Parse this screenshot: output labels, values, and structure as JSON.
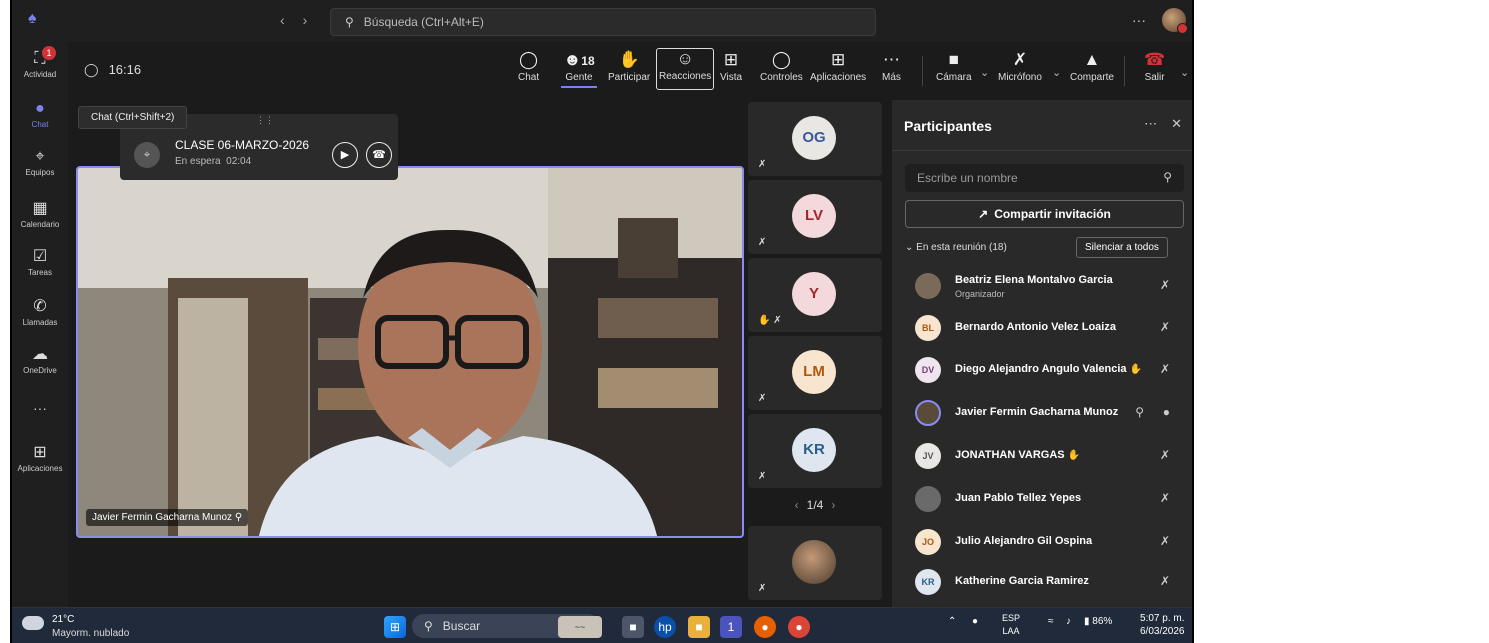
{
  "titlebar": {
    "search_placeholder": "Búsqueda (Ctrl+Alt+E)",
    "more": "···"
  },
  "rail": {
    "activity_badge": "1",
    "items": [
      {
        "label": "Actividad",
        "icon": "bell-icon"
      },
      {
        "label": "Chat",
        "icon": "chat-icon"
      },
      {
        "label": "Equipos",
        "icon": "teams-icon"
      },
      {
        "label": "Calendario",
        "icon": "calendar-icon"
      },
      {
        "label": "Tareas",
        "icon": "tasks-icon"
      },
      {
        "label": "Llamadas",
        "icon": "phone-icon"
      },
      {
        "label": "OneDrive",
        "icon": "cloud-icon"
      },
      {
        "label": "···",
        "icon": "more-icon"
      },
      {
        "label": "Aplicaciones",
        "icon": "apps-icon"
      }
    ]
  },
  "meeting": {
    "elapsed": "16:16",
    "people_count": "18",
    "buttons": {
      "chat": "Chat",
      "people": "Gente",
      "raise": "Participar",
      "react": "Reacciones",
      "view": "Vista",
      "controls": "Controles",
      "apps": "Aplicaciones",
      "more": "Más",
      "camera": "Cámara",
      "mic": "Micrófono",
      "share": "Comparte",
      "leave": "Salir"
    }
  },
  "chat_tooltip": "Chat (Ctrl+Shift+2)",
  "pip": {
    "title": "CLASE 06-MARZO-2026",
    "status": "En espera",
    "time": "02:04"
  },
  "main_video": {
    "name": "Javier Fermin Gacharna Munoz"
  },
  "tiles": [
    {
      "initials": "OG",
      "bg": "#e9e7e3",
      "fg": "#3a5a9a"
    },
    {
      "initials": "LV",
      "bg": "#f3d9db",
      "fg": "#a4262c"
    },
    {
      "initials": "Y",
      "bg": "#f3d9db",
      "fg": "#a4262c"
    },
    {
      "initials": "LM",
      "bg": "#f8e5cf",
      "fg": "#b0570b"
    },
    {
      "initials": "KR",
      "bg": "#dfe6ef",
      "fg": "#2a5e8a"
    }
  ],
  "pager": "1/4",
  "panel": {
    "title": "Participantes",
    "search_placeholder": "Escribe un nombre",
    "share_invite": "Compartir invitación",
    "section": "En esta reunión (18)",
    "mute_all": "Silenciar a todos",
    "people": [
      {
        "initials": "",
        "name": "Beatriz Elena Montalvo Garcia",
        "role": "Organizador",
        "bg": "#7a6a5a",
        "fg": "#fff",
        "hand": false,
        "pinned": false
      },
      {
        "initials": "BL",
        "name": "Bernardo Antonio Velez Loaiza",
        "role": "",
        "bg": "#f8e5cf",
        "fg": "#b0570b",
        "hand": false,
        "pinned": false
      },
      {
        "initials": "DV",
        "name": "Diego Alejandro Angulo Valencia",
        "role": "",
        "bg": "#eee5ee",
        "fg": "#7a3f7a",
        "hand": true,
        "pinned": false
      },
      {
        "initials": "",
        "name": "Javier Fermin Gacharna Munoz",
        "role": "",
        "bg": "#5a4a3a",
        "fg": "#fff",
        "hand": false,
        "pinned": true
      },
      {
        "initials": "JV",
        "name": "JONATHAN VARGAS",
        "role": "",
        "bg": "#e9e7e3",
        "fg": "#555",
        "hand": true,
        "pinned": false
      },
      {
        "initials": "",
        "name": "Juan Pablo Tellez Yepes",
        "role": "",
        "bg": "#6a6a6a",
        "fg": "#fff",
        "hand": false,
        "pinned": false
      },
      {
        "initials": "JO",
        "name": "Julio Alejandro Gil Ospina",
        "role": "",
        "bg": "#f8e5cf",
        "fg": "#b0570b",
        "hand": false,
        "pinned": false
      },
      {
        "initials": "KR",
        "name": "Katherine Garcia Ramirez",
        "role": "",
        "bg": "#dfe6ef",
        "fg": "#2a5e8a",
        "hand": false,
        "pinned": false
      }
    ]
  },
  "taskbar": {
    "temp": "21°C",
    "weather": "Mayorm. nublado",
    "search": "Buscar",
    "lang1": "ESP",
    "lang2": "LAA",
    "battery": "86%",
    "time": "5:07 p. m.",
    "date": "6/03/2026",
    "teams_badge": "1"
  }
}
